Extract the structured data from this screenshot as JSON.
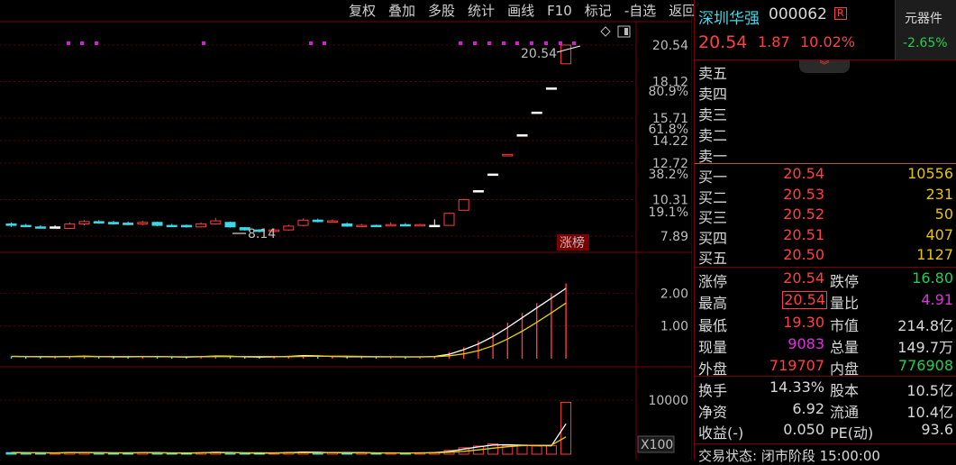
{
  "menu": [
    "复权",
    "叠加",
    "多股",
    "统计",
    "画线",
    "F10",
    "标记",
    "-自选",
    "返回"
  ],
  "chart": {
    "price_axis": [
      "20.54",
      "18.12",
      "15.71",
      "14.22",
      "12.72",
      "10.31",
      "7.89"
    ],
    "pct_axis": [
      "80.9%",
      "61.8%",
      "38.2%",
      "19.1%"
    ],
    "high_label": "20.54",
    "low_label": "8.14",
    "tag": "涨榜",
    "vol_axis": [
      "2.00",
      "1.00"
    ],
    "amt_axis": "10000",
    "amt_unit": "X100",
    "colors": {
      "up": "#ff3b3b",
      "down": "#3cd8e8",
      "flat": "#ffffff",
      "ma_white": "#ffffff",
      "ma_yellow": "#e8d000",
      "marker": "#d020d0"
    }
  },
  "chart_data": {
    "type": "candlestick",
    "ylim": [
      7.89,
      20.54
    ],
    "candles": [
      {
        "o": 8.7,
        "c": 8.6,
        "h": 8.8,
        "l": 8.5
      },
      {
        "o": 8.6,
        "c": 8.55,
        "h": 8.7,
        "l": 8.5
      },
      {
        "o": 8.5,
        "c": 8.45,
        "h": 8.6,
        "l": 8.4
      },
      {
        "o": 8.5,
        "c": 8.5,
        "h": 8.6,
        "l": 8.45
      },
      {
        "o": 8.4,
        "c": 8.7,
        "h": 8.8,
        "l": 8.35
      },
      {
        "o": 8.7,
        "c": 8.85,
        "h": 8.95,
        "l": 8.6
      },
      {
        "o": 8.85,
        "c": 8.75,
        "h": 8.95,
        "l": 8.7
      },
      {
        "o": 8.8,
        "c": 8.7,
        "h": 8.9,
        "l": 8.65
      },
      {
        "o": 8.75,
        "c": 8.65,
        "h": 8.85,
        "l": 8.6
      },
      {
        "o": 8.7,
        "c": 8.8,
        "h": 8.9,
        "l": 8.6
      },
      {
        "o": 8.8,
        "c": 8.6,
        "h": 8.85,
        "l": 8.55
      },
      {
        "o": 8.6,
        "c": 8.55,
        "h": 8.7,
        "l": 8.5
      },
      {
        "o": 8.6,
        "c": 8.5,
        "h": 8.65,
        "l": 8.45
      },
      {
        "o": 8.5,
        "c": 8.7,
        "h": 8.8,
        "l": 8.45
      },
      {
        "o": 8.7,
        "c": 8.9,
        "h": 9.1,
        "l": 8.65
      },
      {
        "o": 8.8,
        "c": 8.5,
        "h": 8.85,
        "l": 8.45
      },
      {
        "o": 8.45,
        "c": 8.3,
        "h": 8.5,
        "l": 8.25
      },
      {
        "o": 8.3,
        "c": 8.2,
        "h": 8.35,
        "l": 8.14
      },
      {
        "o": 8.2,
        "c": 8.3,
        "h": 8.4,
        "l": 8.15
      },
      {
        "o": 8.3,
        "c": 8.55,
        "h": 8.65,
        "l": 8.25
      },
      {
        "o": 8.6,
        "c": 8.95,
        "h": 9.05,
        "l": 8.55
      },
      {
        "o": 8.95,
        "c": 8.85,
        "h": 9.05,
        "l": 8.8
      },
      {
        "o": 8.85,
        "c": 8.9,
        "h": 9.0,
        "l": 8.8
      },
      {
        "o": 8.7,
        "c": 8.55,
        "h": 8.8,
        "l": 8.5
      },
      {
        "o": 8.55,
        "c": 8.6,
        "h": 8.7,
        "l": 8.5
      },
      {
        "o": 8.6,
        "c": 8.55,
        "h": 8.65,
        "l": 8.5
      },
      {
        "o": 8.6,
        "c": 8.65,
        "h": 8.8,
        "l": 8.55
      },
      {
        "o": 8.65,
        "c": 8.6,
        "h": 8.75,
        "l": 8.55
      },
      {
        "o": 8.6,
        "c": 8.65,
        "h": 8.7,
        "l": 8.55
      },
      {
        "o": 8.6,
        "c": 8.6,
        "h": 9.0,
        "l": 8.5
      },
      {
        "o": 8.6,
        "c": 9.4,
        "h": 9.45,
        "l": 8.6
      },
      {
        "o": 9.6,
        "c": 10.3,
        "h": 10.35,
        "l": 9.6
      },
      {
        "o": 10.9,
        "c": 10.9,
        "h": 10.9,
        "l": 10.9
      },
      {
        "o": 12.0,
        "c": 12.0,
        "h": 12.0,
        "l": 12.0
      },
      {
        "o": 13.2,
        "c": 13.3,
        "h": 13.3,
        "l": 13.2
      },
      {
        "o": 14.6,
        "c": 14.6,
        "h": 14.6,
        "l": 14.6
      },
      {
        "o": 16.1,
        "c": 16.1,
        "h": 16.1,
        "l": 16.1
      },
      {
        "o": 17.7,
        "c": 17.7,
        "h": 17.7,
        "l": 17.7
      },
      {
        "o": 19.3,
        "c": 20.54,
        "h": 20.54,
        "l": 19.3
      }
    ],
    "volume": [
      0.07,
      0.06,
      0.06,
      0.05,
      0.08,
      0.07,
      0.06,
      0.05,
      0.06,
      0.07,
      0.06,
      0.05,
      0.05,
      0.07,
      0.09,
      0.06,
      0.05,
      0.05,
      0.06,
      0.08,
      0.1,
      0.07,
      0.06,
      0.06,
      0.06,
      0.05,
      0.06,
      0.05,
      0.06,
      0.07,
      0.2,
      0.35,
      0.55,
      0.8,
      1.1,
      1.4,
      1.7,
      2.0,
      2.3
    ],
    "vol_ylim": [
      0,
      2.7
    ],
    "amount": [
      300,
      250,
      260,
      220,
      340,
      310,
      260,
      210,
      250,
      300,
      260,
      210,
      200,
      290,
      380,
      250,
      200,
      200,
      240,
      330,
      420,
      300,
      250,
      250,
      260,
      220,
      250,
      220,
      260,
      300,
      700,
      1200,
      1500,
      1900,
      1600,
      1700,
      1500,
      1600,
      9600
    ],
    "amt_ylim": [
      0,
      14000
    ]
  },
  "quote": {
    "name": "深圳华强",
    "code": "000062",
    "badge": "R",
    "price": "20.54",
    "change": "1.87",
    "pct": "10.02%",
    "sector": "元器件",
    "sector_pct": "-2.65%"
  },
  "asks": [
    {
      "label": "卖五",
      "price": "",
      "vol": ""
    },
    {
      "label": "卖四",
      "price": "",
      "vol": ""
    },
    {
      "label": "卖三",
      "price": "",
      "vol": ""
    },
    {
      "label": "卖二",
      "price": "",
      "vol": ""
    },
    {
      "label": "卖一",
      "price": "",
      "vol": ""
    }
  ],
  "bids": [
    {
      "label": "买一",
      "price": "20.54",
      "vol": "10556"
    },
    {
      "label": "买二",
      "price": "20.53",
      "vol": "231"
    },
    {
      "label": "买三",
      "price": "20.52",
      "vol": "50"
    },
    {
      "label": "买四",
      "price": "20.51",
      "vol": "407"
    },
    {
      "label": "买五",
      "price": "20.50",
      "vol": "1127"
    }
  ],
  "stats1": [
    {
      "l1": "涨停",
      "v1": "20.54",
      "c1": "red",
      "l2": "跌停",
      "v2": "16.80",
      "c2": "green"
    },
    {
      "l1": "最高",
      "v1": "20.54",
      "c1": "red",
      "l2": "量比",
      "v2": "4.91",
      "c2": "magenta"
    },
    {
      "l1": "最低",
      "v1": "19.30",
      "c1": "red",
      "l2": "市值",
      "v2": "214.8亿",
      "c2": "white"
    },
    {
      "l1": "现量",
      "v1": "9083",
      "c1": "magenta",
      "l2": "总量",
      "v2": "149.7万",
      "c2": "white"
    },
    {
      "l1": "外盘",
      "v1": "719707",
      "c1": "red",
      "l2": "内盘",
      "v2": "776908",
      "c2": "green"
    }
  ],
  "stats2": [
    {
      "l1": "换手",
      "v1": "14.33%",
      "l2": "股本",
      "v2": "10.5亿"
    },
    {
      "l1": "净资",
      "v1": "6.92",
      "l2": "流通",
      "v2": "10.4亿"
    },
    {
      "l1": "收益(-)",
      "v1": "0.050",
      "l2": "PE(动)",
      "v2": "93.6"
    }
  ],
  "status": "交易状态: 闭市阶段 15:00:00"
}
